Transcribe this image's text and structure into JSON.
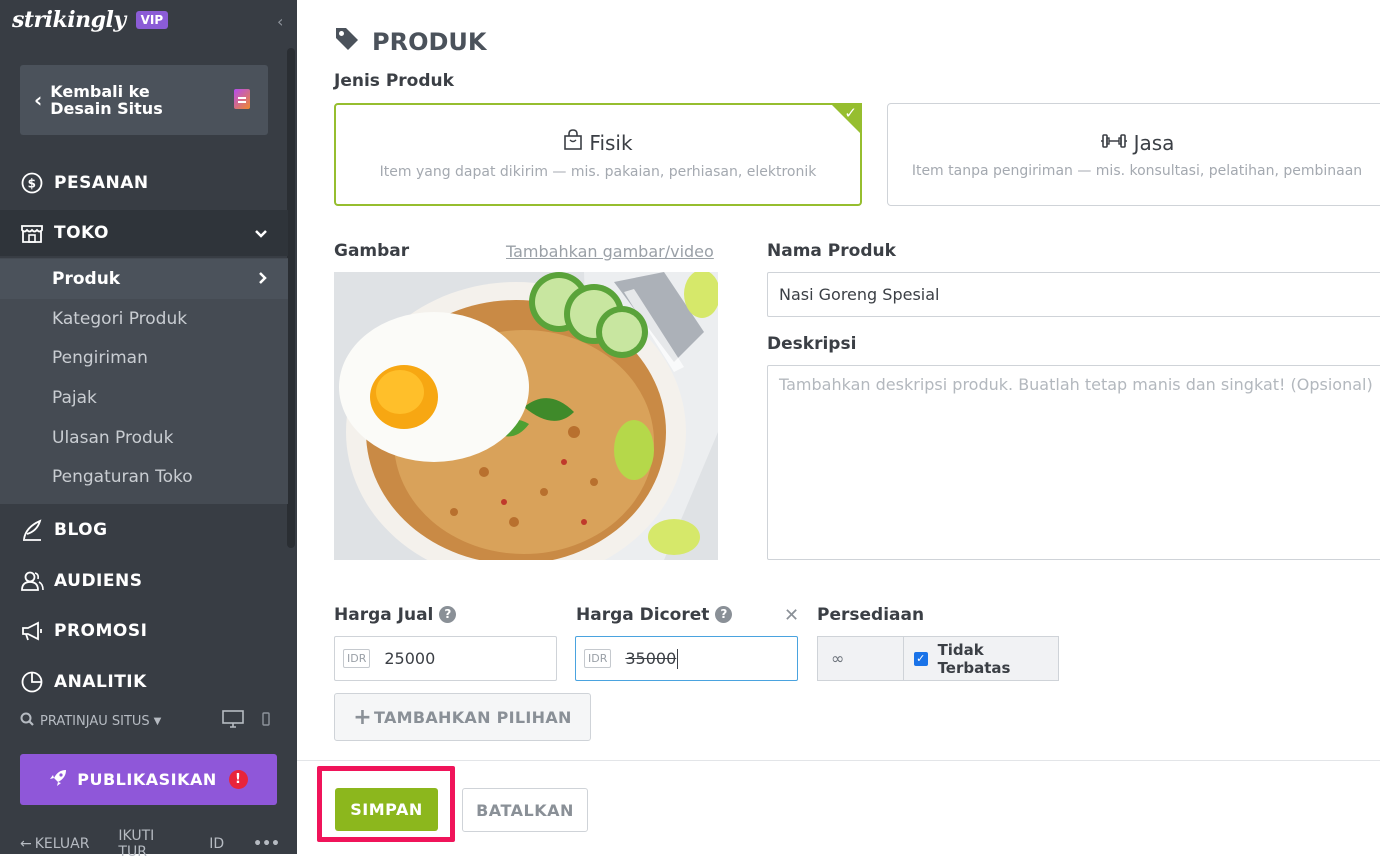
{
  "sidebar": {
    "logo": "strikingly",
    "vip_badge": "VIP",
    "back_label": "Kembali ke Desain Situs",
    "nav": {
      "pesanan": "PESANAN",
      "toko": "TOKO",
      "blog": "BLOG",
      "audiens": "AUDIENS",
      "promosi": "PROMOSI",
      "analitik": "ANALITIK"
    },
    "toko_items": [
      "Produk",
      "Kategori Produk",
      "Pengiriman",
      "Pajak",
      "Ulasan Produk",
      "Pengaturan Toko"
    ],
    "preview": "PRATINJAU SITUS",
    "publish": "PUBLIKASIKAN",
    "publish_alert": "!",
    "footer": {
      "logout": "KELUAR",
      "tour": "IKUTI TUR",
      "lang": "ID",
      "more": "•••"
    }
  },
  "main": {
    "title": "PRODUK",
    "type_label": "Jenis Produk",
    "types": [
      {
        "name": "Fisik",
        "desc": "Item yang dapat dikirim — mis. pakaian, perhiasan, elektronik",
        "selected": true
      },
      {
        "name": "Jasa",
        "desc": "Item tanpa pengiriman — mis. konsultasi, pelatihan, pembinaan",
        "selected": false
      }
    ],
    "image_label": "Gambar",
    "add_media": "Tambahkan gambar/video",
    "name_label": "Nama Produk",
    "name_value": "Nasi Goreng Spesial",
    "desc_label": "Deskripsi",
    "desc_placeholder": "Tambahkan deskripsi produk. Buatlah tetap manis dan singkat! (Opsional)",
    "price_label": "Harga Jual",
    "price_currency": "IDR",
    "price_value": "25000",
    "strike_label": "Harga Dicoret",
    "strike_currency": "IDR",
    "strike_value": "35000",
    "stock_label": "Persediaan",
    "stock_value": "∞",
    "unlimited_label": "Tidak Terbatas",
    "unlimited_checked": true,
    "add_option": "TAMBAHKAN PILIHAN",
    "save": "SIMPAN",
    "cancel": "BATALKAN"
  },
  "colors": {
    "accent_green": "#8cb71d",
    "publish_purple": "#8f57d9",
    "highlight": "#f0145a",
    "sidebar_bg": "#383d44"
  }
}
